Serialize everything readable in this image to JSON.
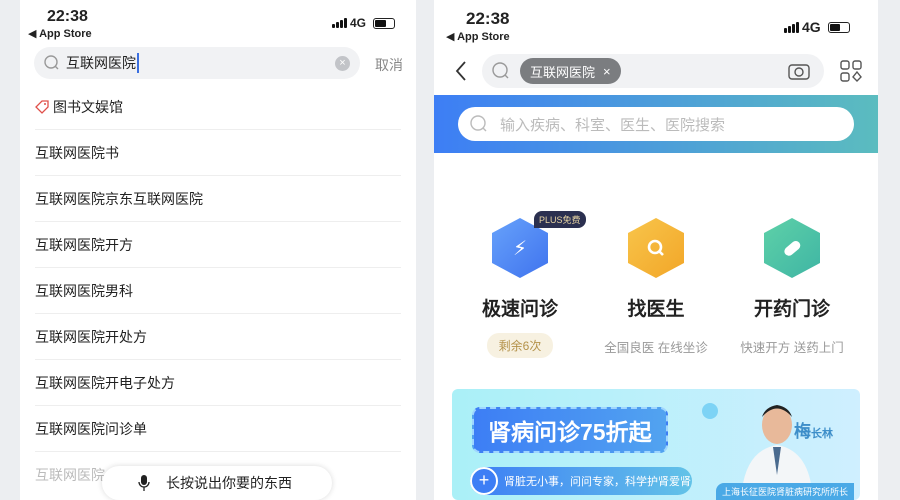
{
  "left": {
    "status": {
      "time": "22:38",
      "back": "◀ App Store",
      "network": "4G"
    },
    "search": {
      "value": "互联网医院",
      "cancel": "取消"
    },
    "suggestions": [
      "图书文娱馆",
      "互联网医院书",
      "互联网医院京东互联网医院",
      "互联网医院开方",
      "互联网医院男科",
      "互联网医院开处方",
      "互联网医院开电子处方",
      "互联网医院问诊单",
      "互联网医院"
    ],
    "voice_hint": "长按说出你要的东西"
  },
  "right": {
    "status": {
      "time": "22:38",
      "back": "◀ App Store",
      "network": "4G"
    },
    "search_chip": "互联网医院",
    "inner_search_placeholder": "输入疾病、科室、医生、医院搜索",
    "services": [
      {
        "title": "极速问诊",
        "badge": "PLUS免费",
        "sub": "剩余6次",
        "color": "#4f8ef7"
      },
      {
        "title": "找医生",
        "sub": "全国良医 在线坐诊",
        "color": "#f5b335"
      },
      {
        "title": "开药门诊",
        "sub": "快速开方 送药上门",
        "color": "#4fc3a6"
      }
    ],
    "ad": {
      "title": "肾病问诊75折起",
      "subtitle": "肾脏无小事，问问专家，科学护肾爱肾",
      "doctor_surname": "梅",
      "doctor_given": "长林",
      "doctor_title": "上海长征医院肾脏病研究所所长"
    }
  }
}
